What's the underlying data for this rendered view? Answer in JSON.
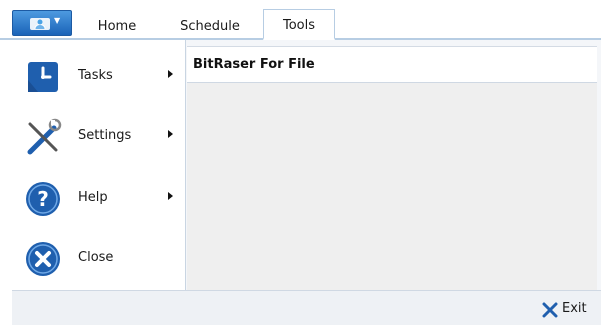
{
  "ribbon": {
    "tabs": [
      {
        "label": "Home"
      },
      {
        "label": "Schedule"
      },
      {
        "label": "Tools"
      }
    ],
    "active_tab": "Tools",
    "accent": "#1a63b8"
  },
  "app_menu": {
    "items": [
      {
        "label": "Tasks",
        "icon": "clock-icon",
        "has_submenu": true
      },
      {
        "label": "Settings",
        "icon": "tools-icon",
        "has_submenu": true
      },
      {
        "label": "Help",
        "icon": "help-icon",
        "has_submenu": true
      },
      {
        "label": "Close",
        "icon": "close-icon",
        "has_submenu": false
      }
    ]
  },
  "content": {
    "title": "BitRaser For File"
  },
  "statusbar": {
    "exit_label": "Exit"
  },
  "colors": {
    "border": "#b7cde3",
    "icon_blue": "#1f5fae",
    "panel_bg": "#efefef"
  }
}
